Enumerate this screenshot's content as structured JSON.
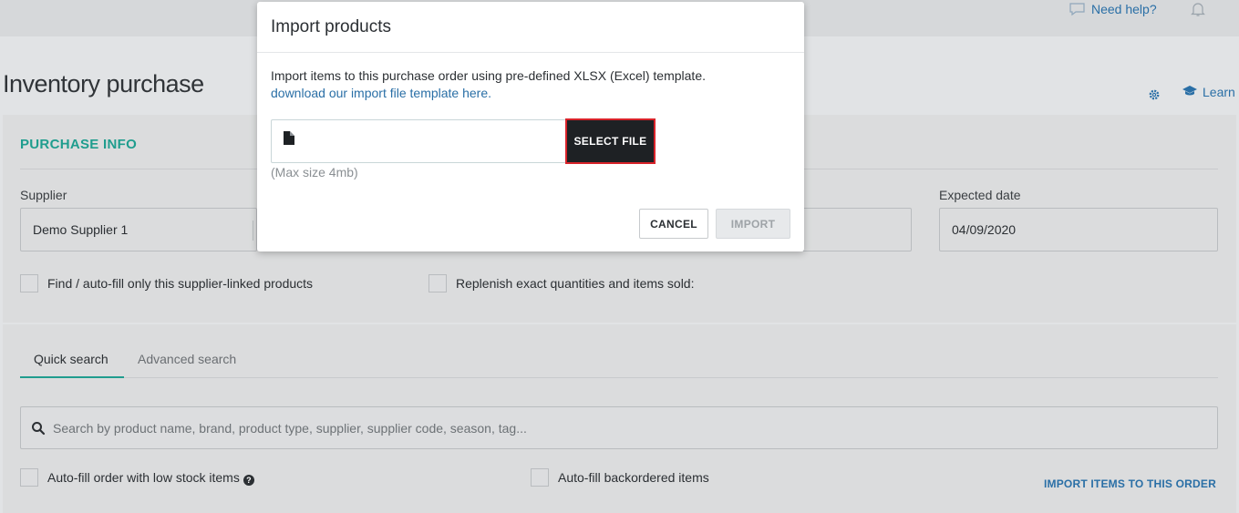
{
  "topbar": {
    "help_label": "Need help?",
    "chat_icon": "chat-bubble-icon",
    "bell_icon": "bell-icon"
  },
  "page": {
    "title": "Inventory purchase",
    "settings_icon": "gear-icon",
    "learn_label": "Learn",
    "learn_icon": "graduation-cap-icon"
  },
  "purchase_info": {
    "section_title": "PURCHASE INFO",
    "supplier_label": "Supplier",
    "supplier_value": "Demo Supplier 1",
    "expected_date_label": "Expected date",
    "expected_date_value": "04/09/2020",
    "checkbox_supplier_linked": "Find / auto-fill only this supplier-linked products",
    "checkbox_replenish": "Replenish exact quantities and items sold:"
  },
  "search": {
    "tabs": [
      {
        "label": "Quick search",
        "active": true
      },
      {
        "label": "Advanced search",
        "active": false
      }
    ],
    "placeholder": "Search by product name, brand, product type, supplier, supplier code, season, tag...",
    "checkbox_low_stock": "Auto-fill order with low stock items",
    "checkbox_backordered": "Auto-fill backordered items",
    "import_link": "IMPORT ITEMS TO THIS ORDER"
  },
  "modal": {
    "title": "Import products",
    "description": "Import items to this purchase order using pre-defined XLSX (Excel) template.",
    "template_link": "download our import file template here.",
    "file_icon": "file-icon",
    "select_file_label": "SELECT FILE",
    "max_size_note": "(Max size 4mb)",
    "cancel_label": "CANCEL",
    "import_label": "IMPORT",
    "import_disabled": true
  },
  "colors": {
    "accent_teal": "#1f9d8e",
    "link_blue": "#2a6fa6",
    "select_file_bg": "#1e2124",
    "highlight_red": "#d8232a"
  }
}
